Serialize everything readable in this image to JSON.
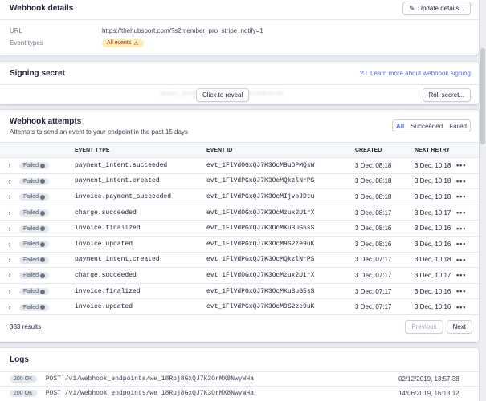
{
  "details": {
    "title": "Webhook details",
    "update_button": "Update details...",
    "url_label": "URL",
    "url_value": "https://thehubsport.com/?s2member_pro_stripe_notify=1",
    "events_label": "Event types",
    "events_value": "All events"
  },
  "signing": {
    "title": "Signing secret",
    "learn_link": "Learn more about webhook signing",
    "secret_masked": "whsec_8FeTuUYxV9ZlMCPzWq32JkBcRrN6",
    "reveal_button": "Click to reveal",
    "roll_button": "Roll secret..."
  },
  "attempts": {
    "title": "Webhook attempts",
    "subtitle": "Attempts to send an event to your endpoint in the past 15 days",
    "filters": [
      "All",
      "Succeeded",
      "Failed"
    ],
    "columns": {
      "type": "EVENT TYPE",
      "id": "EVENT ID",
      "created": "CREATED",
      "retry": "NEXT RETRY"
    },
    "rows": [
      {
        "status": "Failed",
        "type": "payment_intent.succeeded",
        "id": "evt_1FlVdOGxQJ7K3OcM9uDPMQsW",
        "created": "3 Dec, 08:18",
        "retry": "3 Dec, 10:18"
      },
      {
        "status": "Failed",
        "type": "payment_intent.created",
        "id": "evt_1FlVdPGxQJ7K3OcMQkzlNrPS",
        "created": "3 Dec, 08:18",
        "retry": "3 Dec, 10:18"
      },
      {
        "status": "Failed",
        "type": "invoice.payment_succeeded",
        "id": "evt_1FlVdPGxQJ7K3OcMIjvoJDtu",
        "created": "3 Dec, 08:18",
        "retry": "3 Dec, 10:18"
      },
      {
        "status": "Failed",
        "type": "charge.succeeded",
        "id": "evt_1FlVdOGxQJ7K3OcMzux2U1rX",
        "created": "3 Dec, 08:17",
        "retry": "3 Dec, 10:17"
      },
      {
        "status": "Failed",
        "type": "invoice.finalized",
        "id": "evt_1FlVdPGxQJ7K3OcMKu3uG5sS",
        "created": "3 Dec, 08:16",
        "retry": "3 Dec, 10:16"
      },
      {
        "status": "Failed",
        "type": "invoice.updated",
        "id": "evt_1FlVdPGxQJ7K3OcM9S2ze9uK",
        "created": "3 Dec, 08:16",
        "retry": "3 Dec, 10:16"
      },
      {
        "status": "Failed",
        "type": "payment_intent.created",
        "id": "evt_1FlVdPGxQJ7K3OcMQkzlNrPS",
        "created": "3 Dec, 07:17",
        "retry": "3 Dec, 10:18"
      },
      {
        "status": "Failed",
        "type": "charge.succeeded",
        "id": "evt_1FlVdOGxQJ7K3OcMzux2U1rX",
        "created": "3 Dec, 07:17",
        "retry": "3 Dec, 10:17"
      },
      {
        "status": "Failed",
        "type": "invoice.finalized",
        "id": "evt_1FlVdPGxQJ7K3OcMKu3uG5sS",
        "created": "3 Dec, 07:17",
        "retry": "3 Dec, 10:16"
      },
      {
        "status": "Failed",
        "type": "invoice.updated",
        "id": "evt_1FlVdPGxQJ7K3OcM9S2ze9uK",
        "created": "3 Dec, 07:17",
        "retry": "3 Dec, 10:16"
      }
    ],
    "results": "383 results",
    "prev_button": "Previous",
    "next_button": "Next"
  },
  "logs": {
    "title": "Logs",
    "rows": [
      {
        "status": "200 OK",
        "request": "POST /v1/webhook_endpoints/we_18Rpj8GxQJ7K3OrMX8NwyWHa",
        "time": "02/12/2019, 13:57:38"
      },
      {
        "status": "200 OK",
        "request": "POST /v1/webhook_endpoints/we_18Rpj8GxQJ7K3OrMX8NwyWHa",
        "time": "14/06/2019, 16:13:12"
      }
    ]
  },
  "colors": {
    "accent": "#5469d4",
    "warn_bg": "#fcedb9",
    "warn_text": "#a82c00"
  },
  "icons": {
    "update": "pencil-icon",
    "warning": "warning-icon",
    "help": "help-circle-icon",
    "status": "clock-icon",
    "expand": "chevron-right-icon",
    "more": "more-dots-icon"
  }
}
